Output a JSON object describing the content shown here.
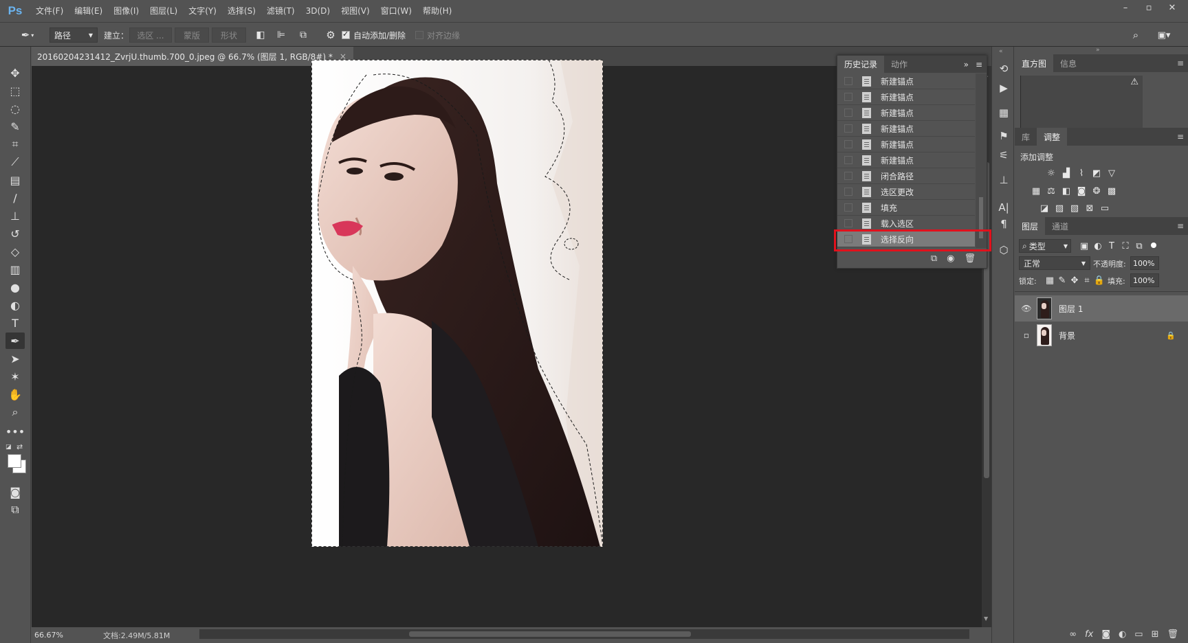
{
  "app": {
    "logo": "Ps"
  },
  "menu": [
    "文件(F)",
    "编辑(E)",
    "图像(I)",
    "图层(L)",
    "文字(Y)",
    "选择(S)",
    "滤镜(T)",
    "3D(D)",
    "视图(V)",
    "窗口(W)",
    "帮助(H)"
  ],
  "window_controls": {
    "minimize": "–",
    "restore": "▫",
    "close": "✕"
  },
  "options": {
    "mode": "路径",
    "make_label": "建立：",
    "selection_btn": "选区 ...",
    "mask_btn": "蒙版",
    "shape_btn": "形状",
    "auto_add_delete": "自动添加/删除",
    "align_edges": "对齐边缘"
  },
  "document": {
    "tab_title": "20160204231412_ZvrjU.thumb.700_0.jpeg @ 66.7% (图层 1, RGB/8#) *",
    "close": "×",
    "zoom": "66.67%",
    "doc_info": "文档:2.49M/5.81M"
  },
  "history_panel": {
    "tabs": [
      "历史记录",
      "动作"
    ],
    "items": [
      {
        "label": "新建锚点",
        "icon": "doc-icon"
      },
      {
        "label": "新建锚点",
        "icon": "doc-icon"
      },
      {
        "label": "新建锚点",
        "icon": "doc-icon"
      },
      {
        "label": "新建锚点",
        "icon": "doc-icon"
      },
      {
        "label": "新建锚点",
        "icon": "doc-icon"
      },
      {
        "label": "新建锚点",
        "icon": "doc-icon"
      },
      {
        "label": "闭合路径",
        "icon": "doc-icon"
      },
      {
        "label": "选区更改",
        "icon": "doc-icon"
      },
      {
        "label": "填充",
        "icon": "list-icon"
      },
      {
        "label": "载入选区",
        "icon": "doc-icon"
      },
      {
        "label": "选择反向",
        "icon": "doc-icon"
      }
    ],
    "selected_index": 10
  },
  "histogram_panel": {
    "tabs": [
      "直方图",
      "信息"
    ],
    "warning": "⚠"
  },
  "adjustments_panel": {
    "tabs": [
      "库",
      "调整"
    ],
    "title": "添加调整"
  },
  "layers_panel": {
    "tabs": [
      "图层",
      "通道"
    ],
    "filter": "类型",
    "blend_mode": "正常",
    "opacity_label": "不透明度:",
    "opacity": "100%",
    "lock_label": "锁定:",
    "fill_label": "填充:",
    "fill": "100%",
    "layers": [
      {
        "name": "图层 1",
        "visible": true,
        "locked": false,
        "selected": true
      },
      {
        "name": "背景",
        "visible": false,
        "locked": true,
        "selected": false
      }
    ],
    "footer_icons": [
      "link-icon",
      "fx-icon",
      "mask-icon",
      "adjustment-icon",
      "folder-icon",
      "new-layer-icon",
      "trash-icon"
    ]
  },
  "colors": {
    "accent_highlight": "#e1111c",
    "canvas_bg": "#282828",
    "panel_bg": "#535353"
  }
}
